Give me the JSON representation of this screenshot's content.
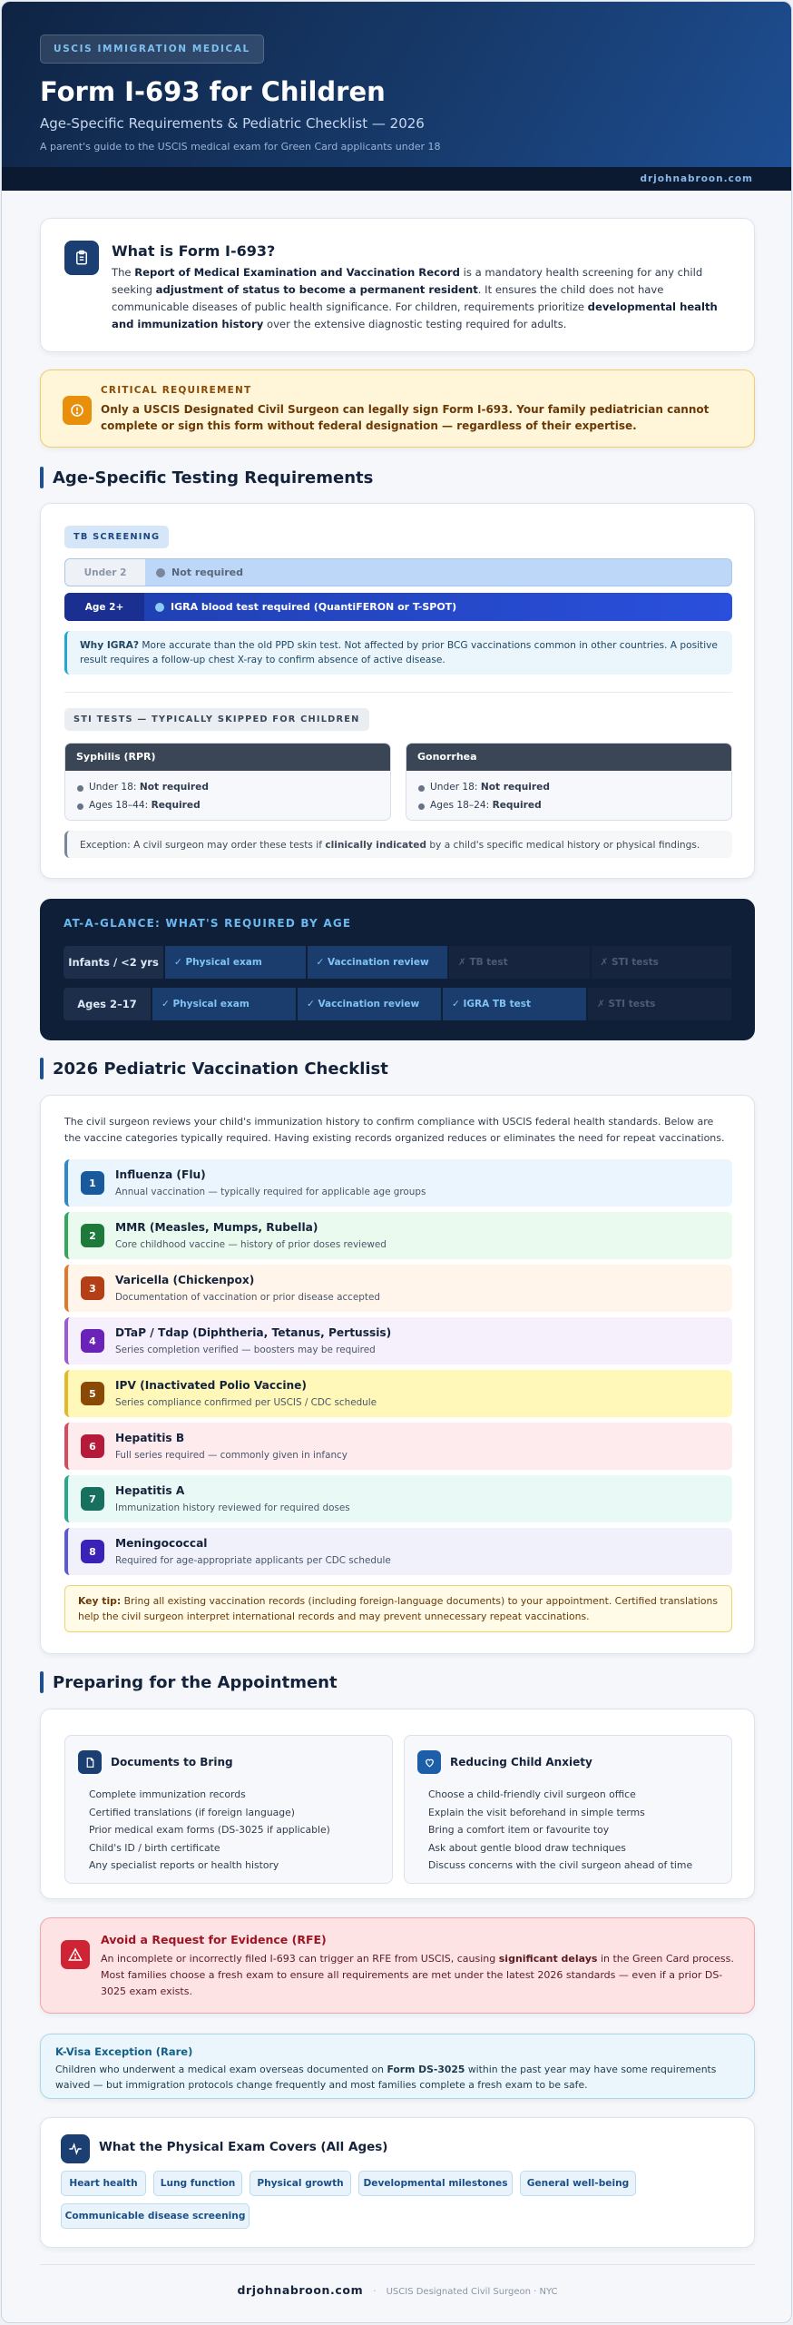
{
  "header": {
    "eyebrow": "USCIS IMMIGRATION MEDICAL",
    "title": "Form I-693 for Children",
    "subtitle": "Age-Specific Requirements & Pediatric Checklist — 2026",
    "tagline": "A parent's guide to the USCIS medical exam for Green Card applicants under 18",
    "site": "drjohnabroon.com"
  },
  "what": {
    "title": "What is Form I-693?",
    "p1": "The ",
    "b1": "Report of Medical Examination and Vaccination Record",
    "p2": " is a mandatory health screening for any child seeking ",
    "b2": "adjustment of status to become a permanent resident",
    "p3": ". It ensures the child does not have communicable diseases of public health significance. For children, requirements prioritize ",
    "b3": "developmental health and immunization history",
    "p4": " over the extensive diagnostic testing required for adults."
  },
  "critical": {
    "label": "CRITICAL REQUIREMENT",
    "text": "Only a USCIS Designated Civil Surgeon can legally sign Form I-693. Your family pediatrician cannot complete or sign this form without federal designation — regardless of their expertise."
  },
  "testing": {
    "title": "Age-Specific Testing Requirements",
    "tb_label": "TB SCREENING",
    "tb_rows": [
      {
        "age": "Under 2",
        "value": "Not required"
      },
      {
        "age": "Age 2+",
        "value": "IGRA blood test required (QuantiFERON or T-SPOT)"
      }
    ],
    "igra_b": "Why IGRA?",
    "igra_text": " More accurate than the old PPD skin test. Not affected by prior BCG vaccinations common in other countries. A positive result requires a follow-up chest X-ray to confirm absence of active disease.",
    "sti_label": "STI TESTS — TYPICALLY SKIPPED FOR CHILDREN",
    "sti": [
      {
        "name": "Syphilis (RPR)",
        "l1a": "Under 18: ",
        "l1b": "Not required",
        "l2a": "Ages 18–44: ",
        "l2b": "Required"
      },
      {
        "name": "Gonorrhea",
        "l1a": "Under 18: ",
        "l1b": "Not required",
        "l2a": "Ages 18–24: ",
        "l2b": "Required"
      }
    ],
    "exc_a": "Exception: A civil surgeon may order these tests if ",
    "exc_b": "clinically indicated",
    "exc_c": " by a child's specific medical history or physical findings."
  },
  "glance": {
    "title": "AT-A-GLANCE: WHAT'S REQUIRED BY AGE",
    "rows": [
      {
        "label": "Infants / <2 yrs",
        "cells": [
          "✓ Physical exam",
          "✓ Vaccination review",
          "✗ TB test",
          "✗ STI tests"
        ]
      },
      {
        "label": "Ages 2–17",
        "cells": [
          "✓ Physical exam",
          "✓ Vaccination review",
          "✓ IGRA TB test",
          "✗ STI tests"
        ]
      }
    ]
  },
  "vaccines": {
    "title": "2026 Pediatric Vaccination Checklist",
    "intro": "The civil surgeon reviews your child's immunization history to confirm compliance with USCIS federal health standards. Below are the vaccine categories typically required. Having existing records organized reduces or eliminates the need for repeat vaccinations.",
    "items": [
      {
        "num": "1",
        "name": "Influenza (Flu)",
        "desc": "Annual vaccination — typically required for applicable age groups"
      },
      {
        "num": "2",
        "name": "MMR (Measles, Mumps, Rubella)",
        "desc": "Core childhood vaccine — history of prior doses reviewed"
      },
      {
        "num": "3",
        "name": "Varicella (Chickenpox)",
        "desc": "Documentation of vaccination or prior disease accepted"
      },
      {
        "num": "4",
        "name": "DTaP / Tdap (Diphtheria, Tetanus, Pertussis)",
        "desc": "Series completion verified — boosters may be required"
      },
      {
        "num": "5",
        "name": "IPV (Inactivated Polio Vaccine)",
        "desc": "Series compliance confirmed per USCIS / CDC schedule"
      },
      {
        "num": "6",
        "name": "Hepatitis B",
        "desc": "Full series required — commonly given in infancy"
      },
      {
        "num": "7",
        "name": "Hepatitis A",
        "desc": "Immunization history reviewed for required doses"
      },
      {
        "num": "8",
        "name": "Meningococcal",
        "desc": "Required for age-appropriate applicants per CDC schedule"
      }
    ],
    "tip_b": "Key tip:",
    "tip_text": " Bring all existing vaccination records (including foreign-language documents) to your appointment. Certified translations help the civil surgeon interpret international records and may prevent unnecessary repeat vaccinations."
  },
  "preparing": {
    "title": "Preparing for the Appointment",
    "docs_title": "Documents to Bring",
    "docs": [
      "Complete immunization records",
      "Certified translations (if foreign language)",
      "Prior medical exam forms (DS-3025 if applicable)",
      "Child's ID / birth certificate",
      "Any specialist reports or health history"
    ],
    "anx_title": "Reducing Child Anxiety",
    "anx": [
      "Choose a child-friendly civil surgeon office",
      "Explain the visit beforehand in simple terms",
      "Bring a comfort item or favourite toy",
      "Ask about gentle blood draw techniques",
      "Discuss concerns with the civil surgeon ahead of time"
    ]
  },
  "rfe": {
    "title": "Avoid a Request for Evidence (RFE)",
    "a": "An incomplete or incorrectly filed I-693 can trigger an RFE from USCIS, causing ",
    "b": "significant delays",
    "c": " in the Green Card process. Most families choose a fresh exam to ensure all requirements are met under the latest 2026 standards — even if a prior DS-3025 exam exists."
  },
  "kvisa": {
    "title": "K-Visa Exception (Rare)",
    "a": "Children who underwent a medical exam overseas documented on ",
    "b": "Form DS-3025",
    "c": " within the past year may have some requirements waived — but immigration protocols change frequently and most families complete a fresh exam to be safe."
  },
  "physical": {
    "title": "What the Physical Exam Covers (All Ages)",
    "chips": [
      "Heart health",
      "Lung function",
      "Physical growth",
      "Developmental milestones",
      "General well-being",
      "Communicable disease screening"
    ]
  },
  "footer": {
    "brand": "drjohnabroon.com",
    "sep": "·",
    "loc": "USCIS Designated Civil Surgeon · NYC"
  },
  "colors": {
    "navy": "#0f2444",
    "accent": "#1f4f8c",
    "critical": "#e8900c",
    "rfe": "#cf2433"
  }
}
